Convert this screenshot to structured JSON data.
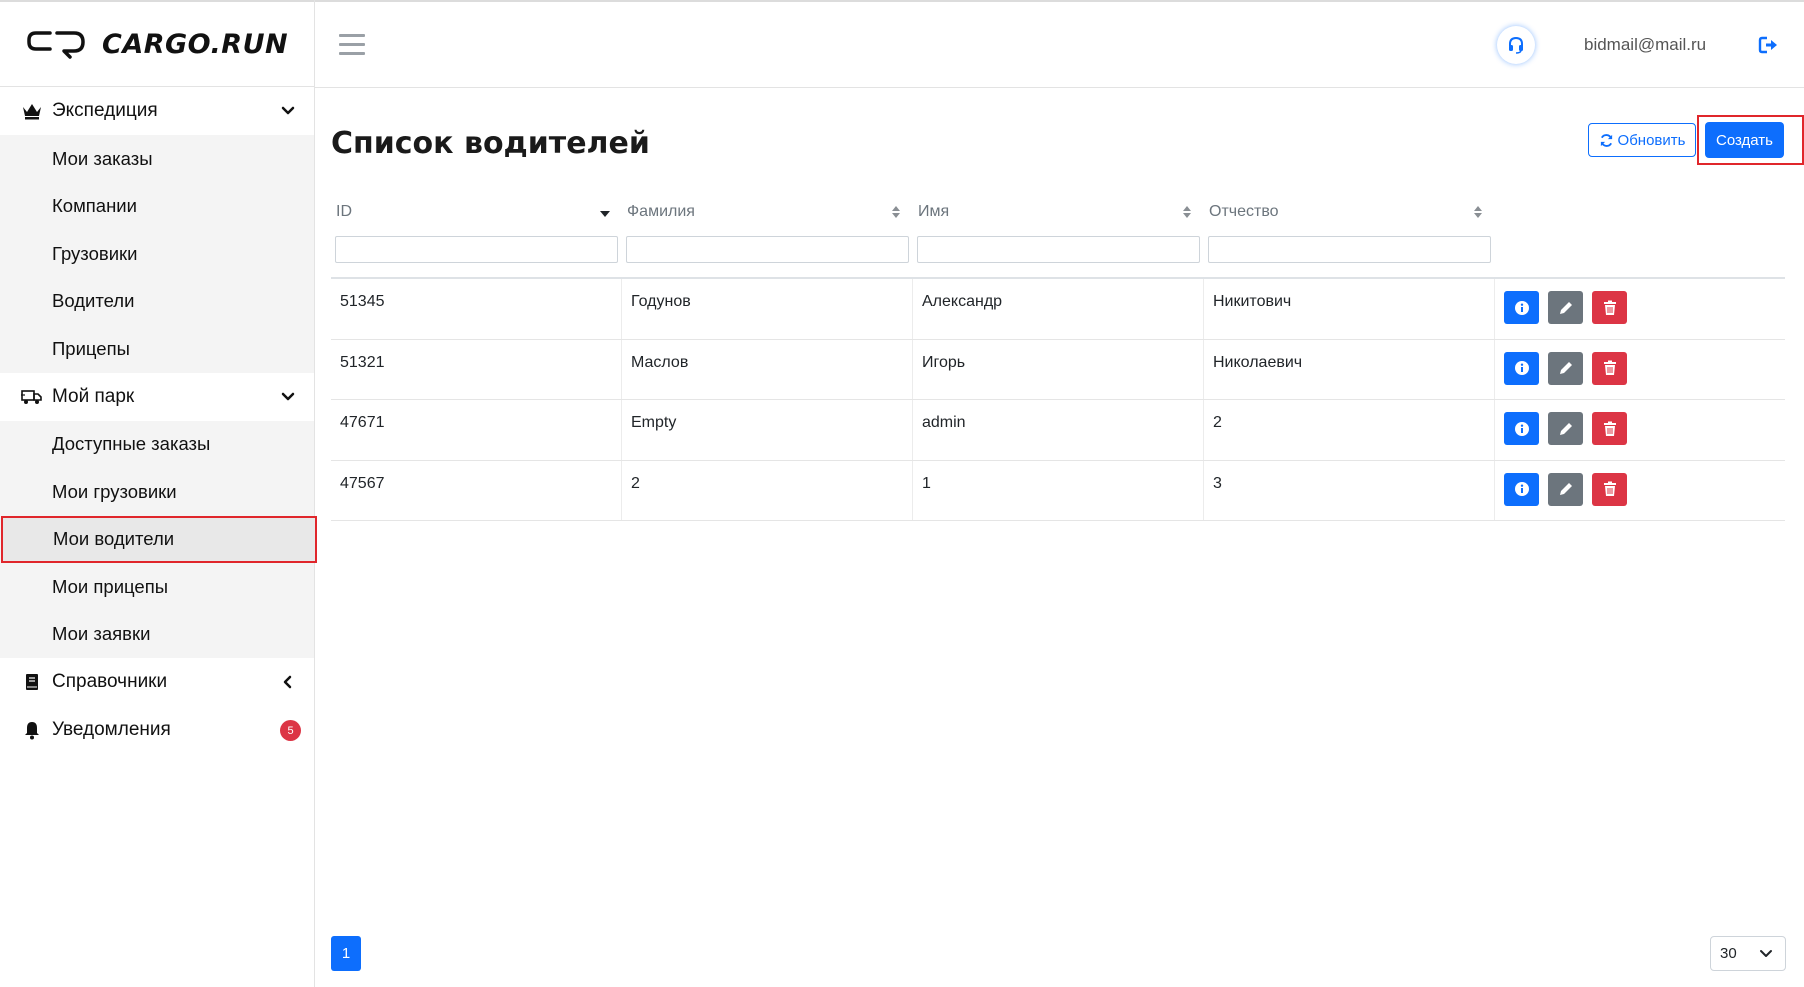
{
  "brand": {
    "name": "CARGO.RUN"
  },
  "sidebar": {
    "sections": [
      {
        "label": "Экспедиция",
        "icon": "crown-icon",
        "expanded": true,
        "items": [
          "Мои заказы",
          "Компании",
          "Грузовики",
          "Водители",
          "Прицепы"
        ]
      },
      {
        "label": "Мой парк",
        "icon": "truck-icon",
        "expanded": true,
        "items": [
          "Доступные заказы",
          "Мои грузовики",
          "Мои водители",
          "Мои прицепы",
          "Мои заявки"
        ]
      },
      {
        "label": "Справочники",
        "icon": "book-icon",
        "expanded": false
      },
      {
        "label": "Уведомления",
        "icon": "bell-icon",
        "badge": "5"
      }
    ],
    "active_item": "Мои водители"
  },
  "header": {
    "menu_icon": "hamburger-icon",
    "support_icon": "headset-icon",
    "user_email": "bidmail@mail.ru",
    "logout_icon": "logout-icon"
  },
  "main": {
    "title": "Список водителей",
    "refresh_label": "Обновить",
    "create_label": "Создать",
    "table": {
      "columns": [
        "ID",
        "Фамилия",
        "Имя",
        "Отчество"
      ],
      "rows": [
        [
          "51345",
          "Годунов",
          "Александр",
          "Никитович"
        ],
        [
          "51321",
          "Маслов",
          "Игорь",
          "Николаевич"
        ],
        [
          "47671",
          "Empty",
          "admin",
          "2"
        ],
        [
          "47567",
          "2",
          "1",
          "3"
        ]
      ]
    },
    "pagination": {
      "current_page": "1",
      "page_size": "30"
    }
  },
  "colors": {
    "primary": "#0d6efd",
    "secondary": "#6c757d",
    "danger": "#dc3545",
    "highlight": "#e0262b"
  }
}
